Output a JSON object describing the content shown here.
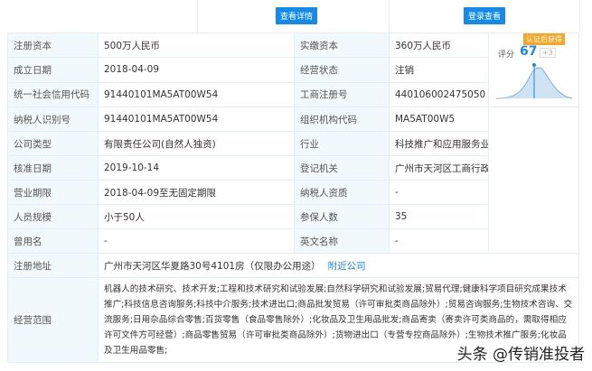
{
  "buttons": {
    "details": "查看详情",
    "login": "登录查看"
  },
  "rows": [
    {
      "l1": "注册资本",
      "v1": "500万人民币",
      "l2": "实缴资本",
      "v2": "360万人民币"
    },
    {
      "l1": "成立日期",
      "v1": "2018-04-09",
      "l2": "经营状态",
      "v2": "注销"
    },
    {
      "l1": "统一社会信用代码",
      "v1": "91440101MA5AT00W54",
      "l2": "工商注册号",
      "v2": "440106002475050"
    },
    {
      "l1": "纳税人识别号",
      "v1": "91440101MA5AT00W54",
      "l2": "组织机构代码",
      "v2": "MA5AT00W5"
    },
    {
      "l1": "公司类型",
      "v1": "有限责任公司(自然人独资)",
      "l2": "行业",
      "v2": "科技推广和应用服务业"
    },
    {
      "l1": "核准日期",
      "v1": "2019-10-14",
      "l2": "登记机关",
      "v2": "广州市天河区工商行政管理局"
    },
    {
      "l1": "营业期限",
      "v1": "2018-04-09至无固定期限",
      "l2": "纳税人资质",
      "v2": "-"
    },
    {
      "l1": "人员规模",
      "v1": "小于50人",
      "l2": "参保人数",
      "v2": "35"
    },
    {
      "l1": "曾用名",
      "v1": "-",
      "l2": "英文名称",
      "v2": "-"
    }
  ],
  "address": {
    "label": "注册地址",
    "value": "广州市天河区华夏路30号4101房（仅限办公用途）",
    "link": "附近公司"
  },
  "scope": {
    "label": "经营范围",
    "value": "机器人的技术研究、技术开发;工程和技术研究和试验发展;自然科学研究和试验发展;贸易代理;健康科学项目研究成果技术推广;科技信息咨询服务;科技中介服务;技术进出口;商品批发贸易（许可审批类商品除外）;贸易咨询服务;生物技术咨询、交流服务;日用杂品综合零售;百货零售（食品零售除外）;化妆品及卫生用品批发;商品寄卖（寄卖许可类商品的，需取得相应许可文件方可经营）;商品零售贸易（许可审批类商品除外）;货物进出口（专营专控商品除外）;生物技术推广服务;化妆品及卫生用品零售;"
  },
  "score": {
    "badge": "认证后获得",
    "label": "评分",
    "value": "67",
    "plus": "+3"
  },
  "watermark": "头条 @传销准投者"
}
